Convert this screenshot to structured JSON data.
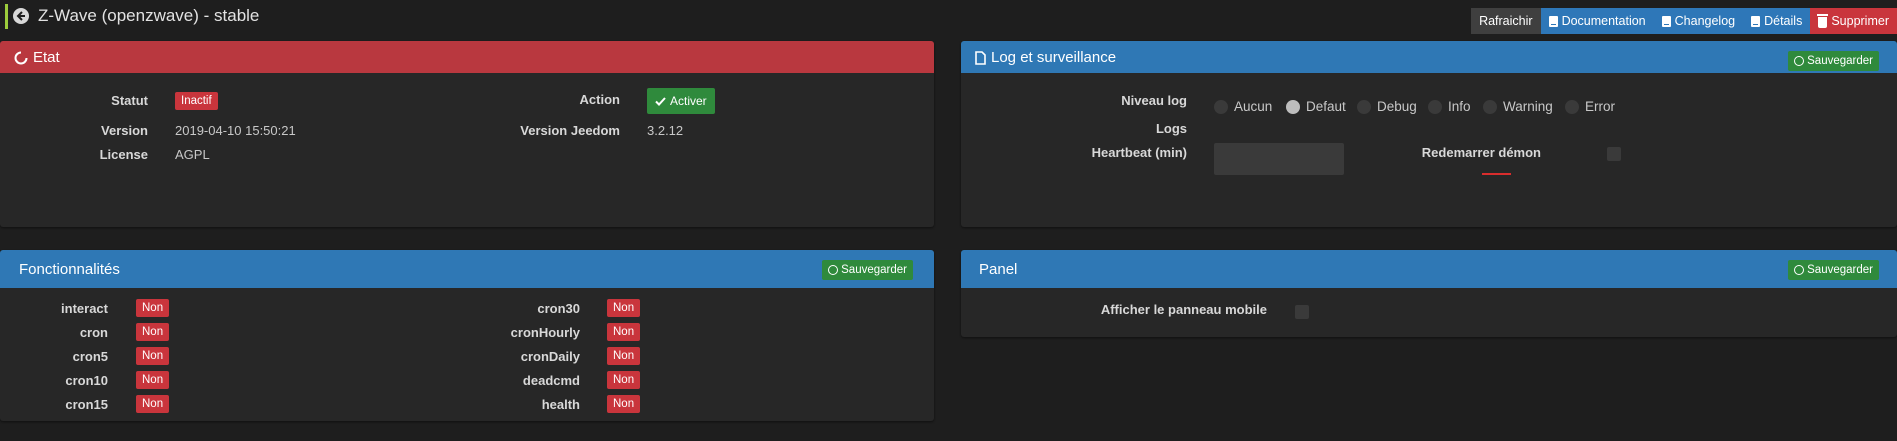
{
  "header": {
    "title": "Z-Wave (openzwave) - stable"
  },
  "toolbar": {
    "refresh": "Rafraichir",
    "documentation": "Documentation",
    "changelog": "Changelog",
    "details": "Détails",
    "delete": "Supprimer"
  },
  "etat": {
    "title": "Etat",
    "statut_label": "Statut",
    "statut_value": "Inactif",
    "action_label": "Action",
    "action_button": "Activer",
    "version_label": "Version",
    "version_value": "2019-04-10 15:50:21",
    "version_jeedom_label": "Version Jeedom",
    "version_jeedom_value": "3.2.12",
    "license_label": "License",
    "license_value": "AGPL"
  },
  "log": {
    "title": "Log et surveillance",
    "save": "Sauvegarder",
    "niveau_label": "Niveau log",
    "levels": [
      "Aucun",
      "Defaut",
      "Debug",
      "Info",
      "Warning",
      "Error"
    ],
    "selected_level": "Defaut",
    "logs_label": "Logs",
    "heartbeat_label": "Heartbeat (min)",
    "heartbeat_value": "",
    "restart_label": "Redemarrer démon"
  },
  "fonctionnalites": {
    "title": "Fonctionnalités",
    "save": "Sauvegarder",
    "left": [
      {
        "name": "interact",
        "value": "Non"
      },
      {
        "name": "cron",
        "value": "Non"
      },
      {
        "name": "cron5",
        "value": "Non"
      },
      {
        "name": "cron10",
        "value": "Non"
      },
      {
        "name": "cron15",
        "value": "Non"
      }
    ],
    "right": [
      {
        "name": "cron30",
        "value": "Non"
      },
      {
        "name": "cronHourly",
        "value": "Non"
      },
      {
        "name": "cronDaily",
        "value": "Non"
      },
      {
        "name": "deadcmd",
        "value": "Non"
      },
      {
        "name": "health",
        "value": "Non"
      }
    ]
  },
  "panel": {
    "title": "Panel",
    "save": "Sauvegarder",
    "mobile_label": "Afficher le panneau mobile"
  },
  "colors": {
    "red": "#b9383f",
    "blue": "#2f78b5",
    "green": "#2f8a3c",
    "accent": "#9ccc3c"
  }
}
